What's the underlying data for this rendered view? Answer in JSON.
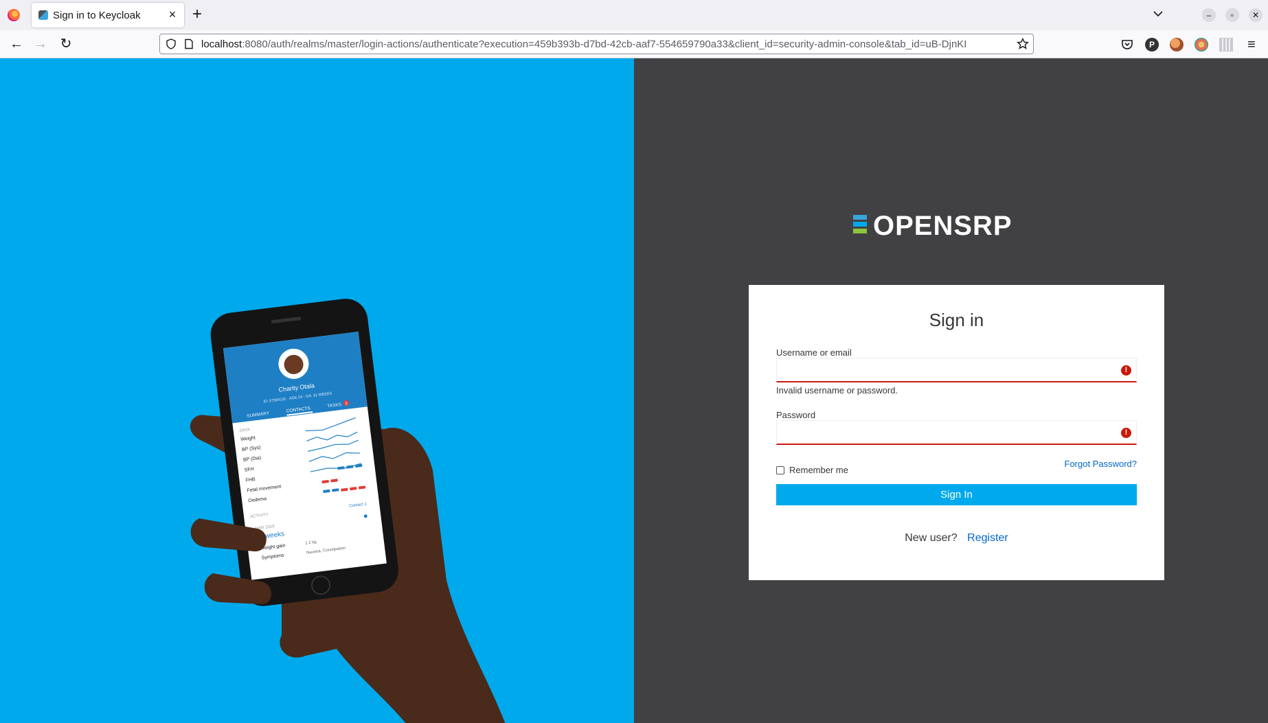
{
  "browser": {
    "tab_title": "Sign in to Keycloak",
    "url_host": "localhost",
    "url_rest": ":8080/auth/realms/master/login-actions/authenticate?execution=459b393b-d7bd-42cb-aaf7-554659790a33&client_id=security-admin-console&tab_id=uB-DjnKI",
    "profile_initial": "P"
  },
  "brand": {
    "name": "OPENSRP",
    "colors": [
      "#39a5dc",
      "#00a9ec",
      "#8cc63f"
    ]
  },
  "login": {
    "title": "Sign in",
    "username_label": "Username or email",
    "error_message": "Invalid username or password.",
    "password_label": "Password",
    "remember_label": "Remember me",
    "forgot_link": "Forgot Password?",
    "submit_label": "Sign In",
    "new_user_text": "New user?",
    "register_link": "Register",
    "error_color": "#c9190b",
    "accent_color": "#00a9ec"
  },
  "phone_screen": {
    "patient_name": "Charity Otala",
    "patient_meta": "ID: 07564131 · AGE 24 · GA: 31 WEEKS",
    "tabs": [
      "SUMMARY",
      "CONTACTS",
      "TASKS"
    ],
    "tasks_badge": "3",
    "section_data": "DATA",
    "rows": [
      "Weight",
      "BP (Sys)",
      "BP (Dia)",
      "SFH",
      "FHB",
      "Fetal movement",
      "Oedema"
    ],
    "section_activity": "ACTIVITY",
    "contact_label": "Contact 1",
    "date_label": "MAR 2018",
    "weeks_label": "11 weeks",
    "weight_gain_label": "Weight gain",
    "weight_gain_value": "1.2 kg",
    "symptoms_label": "Symptoms",
    "symptoms_value": "Nausea, Constipation"
  }
}
